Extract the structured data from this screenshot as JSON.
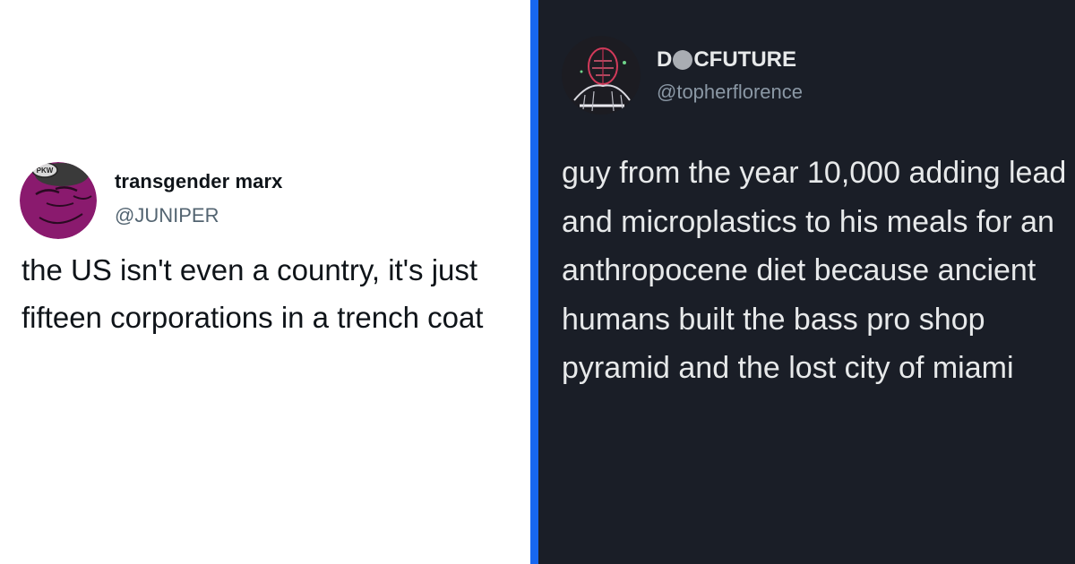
{
  "left_tweet": {
    "display_name": "transgender marx",
    "handle": "@JUNIPER",
    "avatar_hat_text": "PKW",
    "text": "the US isn't even a country, it's just fifteen corporations in a trench coat"
  },
  "right_tweet": {
    "display_name_prefix": "D",
    "display_name_suffix": "CFUTURE",
    "handle": "@topherflorence",
    "text": "guy from the year 10,000 adding lead and microplastics to his meals for an anthropocene diet because ancient humans built the bass pro shop pyramid and the lost city of miami"
  },
  "colors": {
    "divider": "#1767f0",
    "dark_background": "#1a1e27",
    "left_avatar_purple": "#8a1a6e",
    "light_text": "#0f1419",
    "muted_text_light": "#536471",
    "dark_text": "#e7e9ea",
    "muted_text_dark": "#8b98a5"
  }
}
